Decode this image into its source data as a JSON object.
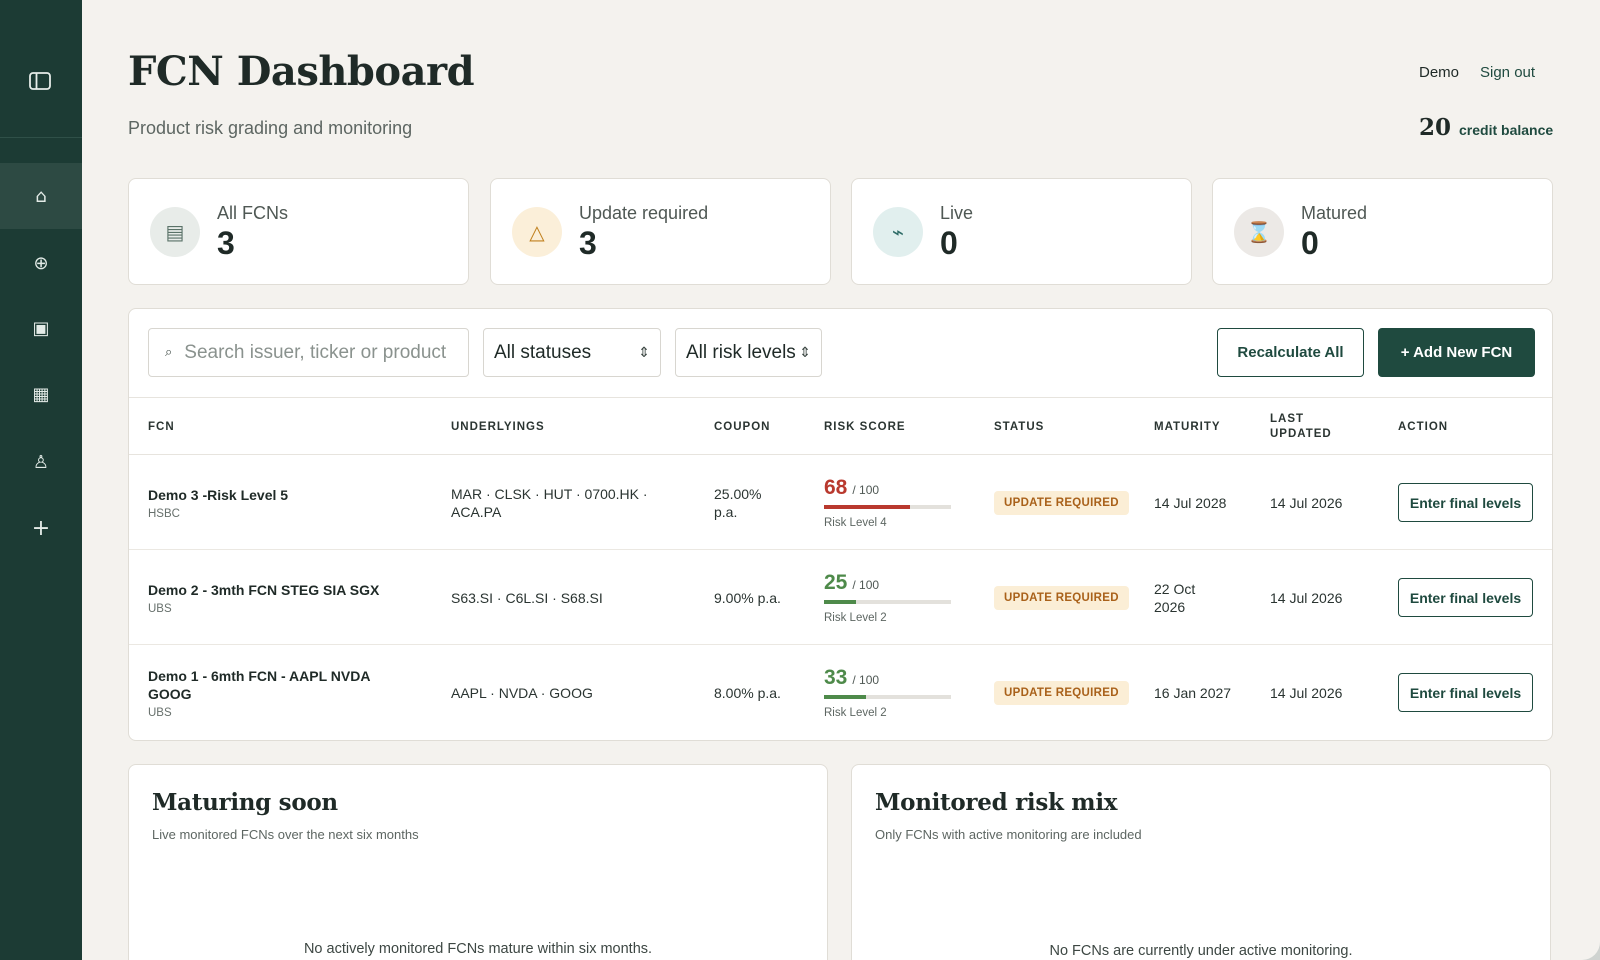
{
  "header": {
    "title": "FCN Dashboard",
    "subtitle": "Product risk grading and monitoring",
    "user": "Demo",
    "signout": "Sign out",
    "credit_value": "20",
    "credit_label": "credit balance"
  },
  "sidebar": {
    "items": [
      {
        "icon": "home-icon",
        "glyph": "⌂"
      },
      {
        "icon": "globe-plus-icon",
        "glyph": "⊕"
      },
      {
        "icon": "square-icon",
        "glyph": "▣"
      },
      {
        "icon": "calendar-icon",
        "glyph": "▦"
      },
      {
        "icon": "flask-icon",
        "glyph": "♙"
      },
      {
        "icon": "plus-icon",
        "glyph": "+"
      }
    ]
  },
  "stats": [
    {
      "label": "All FCNs",
      "value": "3",
      "icon": "document-icon",
      "glyph": "▤",
      "color": "#5a7268",
      "bg": "#e8ece9"
    },
    {
      "label": "Update required",
      "value": "3",
      "icon": "warning-icon",
      "glyph": "△",
      "color": "#c0801e",
      "bg": "#fbefd9"
    },
    {
      "label": "Live",
      "value": "0",
      "icon": "pulse-icon",
      "glyph": "⌁",
      "color": "#2d6b66",
      "bg": "#e1efee"
    },
    {
      "label": "Matured",
      "value": "0",
      "icon": "hourglass-icon",
      "glyph": "⌛",
      "color": "#7a4e2e",
      "bg": "#ece9e6"
    }
  ],
  "toolbar": {
    "search_placeholder": "Search issuer, ticker or product",
    "status_filter": "All statuses",
    "risk_filter": "All risk levels",
    "recalculate_label": "Recalculate All",
    "add_label": "+ Add New FCN"
  },
  "table": {
    "headers": [
      "FCN",
      "UNDERLYINGS",
      "COUPON",
      "RISK SCORE",
      "STATUS",
      "MATURITY",
      "LAST UPDATED",
      "ACTION"
    ],
    "rows": [
      {
        "name": "Demo 3 -Risk Level 5",
        "issuer": "HSBC",
        "underlyings": "MAR · CLSK · HUT · 0700.HK · ACA.PA",
        "coupon": "25.00% p.a.",
        "score": "68",
        "score_max": "/ 100",
        "score_fraction": 0.68,
        "risk_level": "Risk Level 4",
        "score_color": "#b9392e",
        "status": "UPDATE REQUIRED",
        "maturity": "14 Jul 2028",
        "updated": "14 Jul 2026",
        "action": "Enter final levels"
      },
      {
        "name": "Demo 2 - 3mth FCN STEG SIA SGX",
        "issuer": "UBS",
        "underlyings": "S63.SI · C6L.SI · S68.SI",
        "coupon": "9.00% p.a.",
        "score": "25",
        "score_max": "/ 100",
        "score_fraction": 0.25,
        "risk_level": "Risk Level 2",
        "score_color": "#4e8a4a",
        "status": "UPDATE REQUIRED",
        "maturity": "22 Oct 2026",
        "updated": "14 Jul 2026",
        "action": "Enter final levels"
      },
      {
        "name": "Demo 1 - 6mth FCN - AAPL NVDA GOOG",
        "issuer": "UBS",
        "underlyings": "AAPL · NVDA · GOOG",
        "coupon": "8.00% p.a.",
        "score": "33",
        "score_max": "/ 100",
        "score_fraction": 0.33,
        "risk_level": "Risk Level 2",
        "score_color": "#4e8a4a",
        "status": "UPDATE REQUIRED",
        "maturity": "16 Jan 2027",
        "updated": "14 Jul 2026",
        "action": "Enter final levels"
      }
    ]
  },
  "maturing": {
    "title": "Maturing soon",
    "subtitle": "Live monitored FCNs over the next six months",
    "empty": "No actively monitored FCNs mature within six months."
  },
  "riskmix": {
    "title": "Monitored risk mix",
    "subtitle": "Only FCNs with active monitoring are included",
    "empty": "No FCNs are currently under active monitoring."
  }
}
